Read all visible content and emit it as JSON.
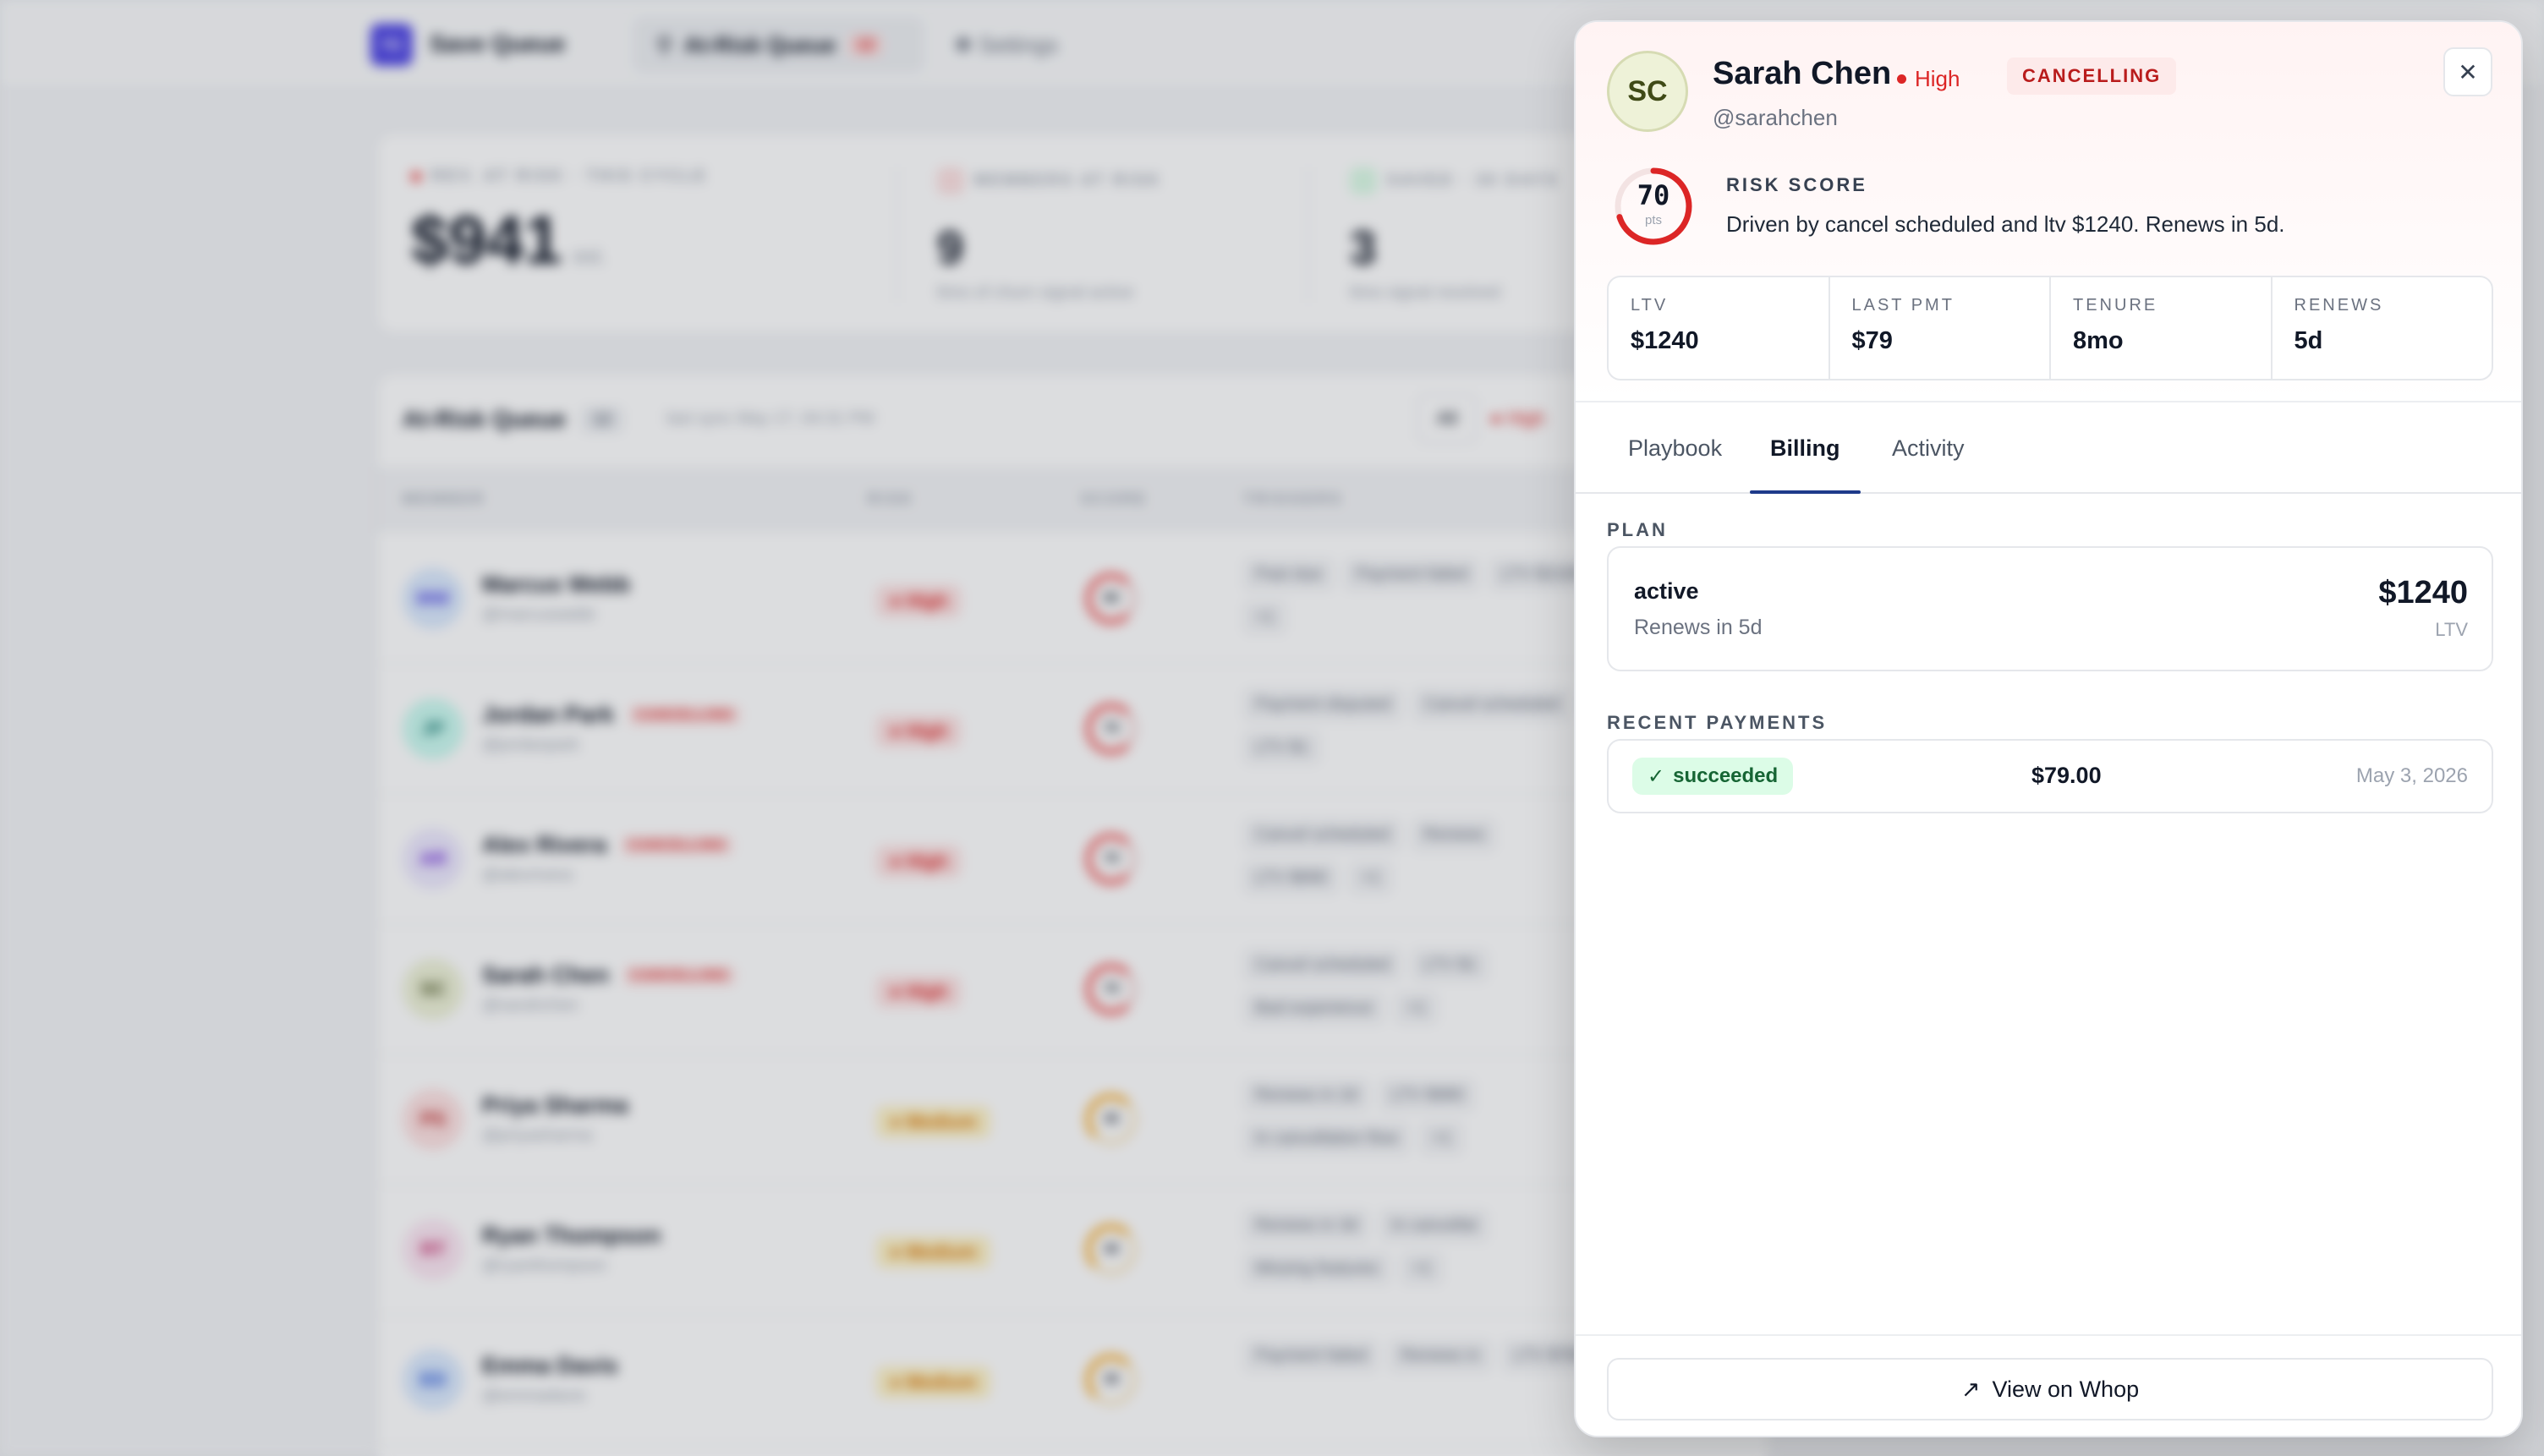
{
  "app": {
    "brand_logo": "SQ",
    "brand_name": "Save Queue",
    "nav": [
      {
        "label": "At-Risk Queue",
        "count": "12"
      },
      {
        "label": "Settings"
      }
    ]
  },
  "stats": [
    {
      "label": "REV. AT RISK · THIS CYCLE",
      "value": "$941",
      "suffix": "est."
    },
    {
      "label": "MEMBERS AT RISK",
      "value": "9",
      "sub": "6mo of churn signal active"
    },
    {
      "label": "SAVED · 30 DAYS",
      "value": "3",
      "sub": "6mo signal resolved"
    }
  ],
  "queue": {
    "title": "At-Risk Queue",
    "count": "12",
    "sync": "last sync May 17, 04:31 PM",
    "filters": [
      "All",
      "High"
    ],
    "columns": [
      "MEMBER",
      "RISK",
      "SCORE",
      "TRIGGERS"
    ],
    "rows": [
      {
        "initials": "MW",
        "name": "Marcus Webb",
        "handle": "@marcuswebb",
        "cancelling": "",
        "risk": "High",
        "score": "80",
        "triggers": [
          "Past due",
          "Payment failed",
          "LTV $2100",
          "+1"
        ]
      },
      {
        "initials": "JP",
        "name": "Jordan Park",
        "handle": "@jordanpark",
        "cancelling": "CANCELLING",
        "risk": "High",
        "score": "75",
        "triggers": [
          "Payment disputed",
          "Cancel scheduled",
          "LTV $1"
        ]
      },
      {
        "initials": "AR",
        "name": "Alex Rivera",
        "handle": "@alexrivera",
        "cancelling": "CANCELLING",
        "risk": "High",
        "score": "70",
        "triggers": [
          "Cancel scheduled",
          "Renews",
          "LTV $890",
          "+1"
        ]
      },
      {
        "initials": "SC",
        "name": "Sarah Chen",
        "handle": "@sarahchen",
        "cancelling": "CANCELLING",
        "risk": "High",
        "score": "70",
        "triggers": [
          "Cancel scheduled",
          "LTV $1",
          "Bad experience",
          "+1"
        ]
      },
      {
        "initials": "PS",
        "name": "Priya Sharma",
        "handle": "@priyasharma",
        "cancelling": "",
        "risk": "Medium",
        "score": "45",
        "triggers": [
          "Renews in 2d",
          "LTV $980",
          "In cancellation flow",
          "+1"
        ]
      },
      {
        "initials": "RT",
        "name": "Ryan Thompson",
        "handle": "@ryanthompson",
        "cancelling": "",
        "risk": "Medium",
        "score": "40",
        "triggers": [
          "Renews in 3d",
          "In cancellat",
          "Missing features",
          "+1"
        ]
      },
      {
        "initials": "ED",
        "name": "Emma Davis",
        "handle": "@emmadavis",
        "cancelling": "",
        "risk": "Medium",
        "score": "35",
        "triggers": [
          "Payment failed",
          "Renews in",
          "LTV $760"
        ]
      }
    ]
  },
  "drawer": {
    "avatar": "SC",
    "name": "Sarah Chen",
    "risk": "High",
    "status_badge": "CANCELLING",
    "handle": "@sarahchen",
    "close_icon": "✕",
    "score": {
      "value": 70,
      "label": "70",
      "unit": "pts",
      "max": 100
    },
    "risk_score_label": "RISK SCORE",
    "risk_score_desc": "Driven by cancel scheduled and ltv $1240. Renews in 5d.",
    "metrics": [
      {
        "label": "LTV",
        "value": "$1240"
      },
      {
        "label": "LAST PMT",
        "value": "$79"
      },
      {
        "label": "TENURE",
        "value": "8mo"
      },
      {
        "label": "RENEWS",
        "value": "5d"
      }
    ],
    "tabs": [
      "Playbook",
      "Billing",
      "Activity"
    ],
    "active_tab": "Billing",
    "plan_label": "PLAN",
    "plan": {
      "status": "active",
      "renews": "Renews in 5d",
      "amount": "$1240",
      "amount_label": "LTV"
    },
    "payments_label": "RECENT PAYMENTS",
    "payments": [
      {
        "status": "succeeded",
        "amount": "$79.00",
        "date": "May 3, 2026"
      }
    ],
    "footer_button": "View on Whop"
  },
  "colors": {
    "accent": "#1e3a8a",
    "danger": "#dc2626",
    "success_bg": "#dcfce7",
    "success_fg": "#166534"
  }
}
